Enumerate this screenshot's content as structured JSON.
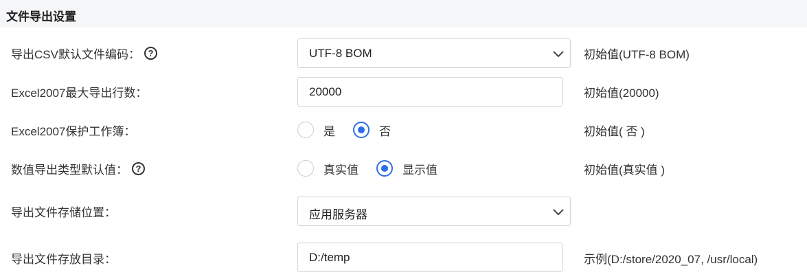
{
  "section": {
    "title": "文件导出设置"
  },
  "rows": {
    "csv_encoding": {
      "label": "导出CSV默认文件编码：",
      "help": "?",
      "value": "UTF-8 BOM",
      "hint": "初始值(UTF-8 BOM)"
    },
    "excel_max_rows": {
      "label": "Excel2007最大导出行数：",
      "value": "20000",
      "hint": "初始值(20000)"
    },
    "excel_protect": {
      "label": "Excel2007保护工作簿：",
      "options": [
        "是",
        "否"
      ],
      "selected": "否",
      "hint": "初始值( 否 )"
    },
    "numeric_type": {
      "label": "数值导出类型默认值：",
      "help": "?",
      "options": [
        "真实值",
        "显示值"
      ],
      "selected": "显示值",
      "hint": "初始值(真实值 )"
    },
    "storage_location": {
      "label": "导出文件存储位置：",
      "value": "应用服务器"
    },
    "storage_dir": {
      "label": "导出文件存放目录：",
      "value": "D:/temp",
      "hint": "示例(D:/store/2020_07, /usr/local)"
    }
  },
  "colors": {
    "accent": "#2b6fe8",
    "header_bg": "#f5f6f8",
    "border": "#cfd3d8"
  }
}
